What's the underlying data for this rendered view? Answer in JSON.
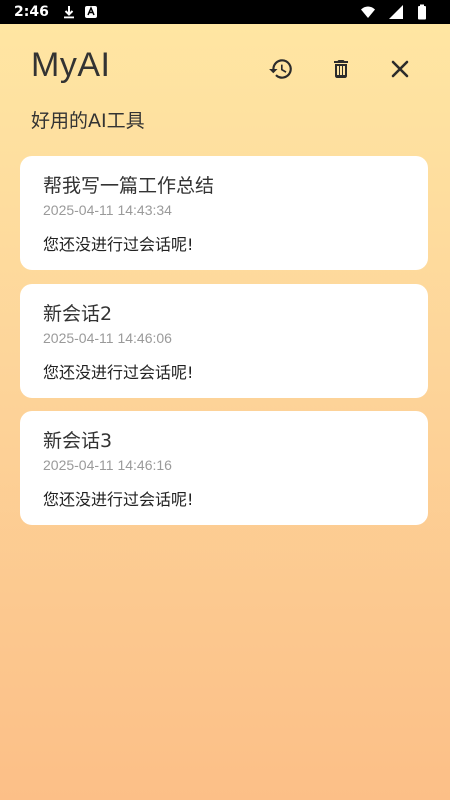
{
  "statusbar": {
    "time": "2:46"
  },
  "header": {
    "title": "MyAI",
    "subtitle": "好用的AI工具",
    "icons": [
      "history-icon",
      "trash-icon",
      "close-icon"
    ]
  },
  "conversations": [
    {
      "title": "帮我写一篇工作总结",
      "date": "2025-04-11 14:43:34",
      "preview": "您还没进行过会话呢!"
    },
    {
      "title": "新会话2",
      "date": "2025-04-11 14:46:06",
      "preview": "您还没进行过会话呢!"
    },
    {
      "title": "新会话3",
      "date": "2025-04-11 14:46:16",
      "preview": "您还没进行过会话呢!"
    }
  ],
  "colors": {
    "gradient_top": "#ffe7a3",
    "gradient_bottom": "#fcbf87",
    "card": "#ffffff",
    "date_text": "#9a9a9a"
  }
}
